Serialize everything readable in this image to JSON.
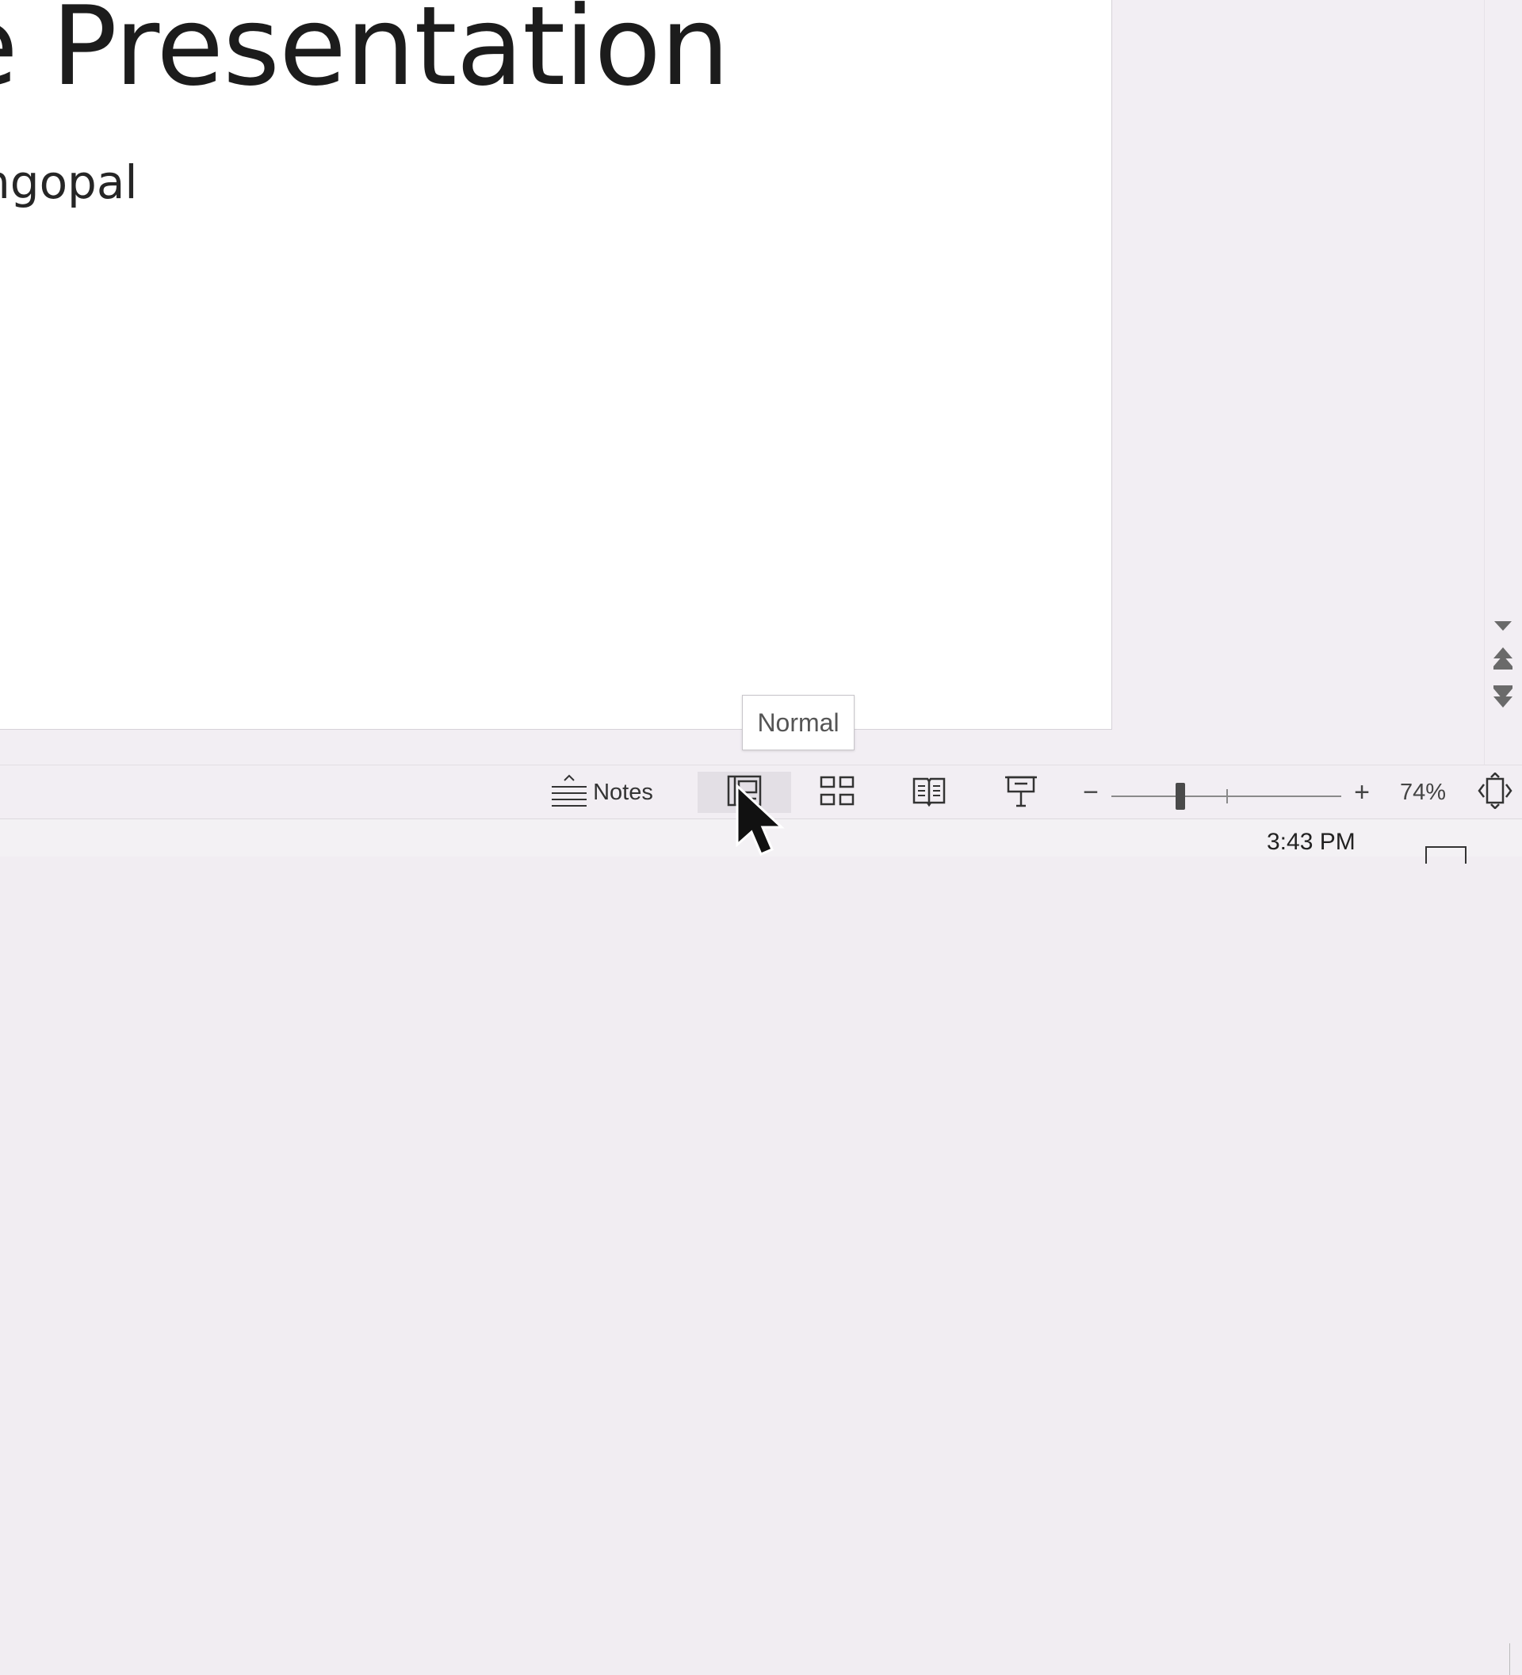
{
  "slide": {
    "title": "e Presentation",
    "subtitle": "ngopal"
  },
  "tooltip": {
    "text": "Normal"
  },
  "status_bar": {
    "notes_label": "Notes",
    "zoom_minus": "−",
    "zoom_plus": "+",
    "zoom_level": "74%",
    "zoom_fraction": 0.3
  },
  "taskbar": {
    "time": "3:43 PM"
  },
  "icons": {
    "notes": "notes-icon",
    "normal_view": "normal-view-icon",
    "slide_sorter": "slide-sorter-icon",
    "reading_view": "reading-view-icon",
    "slide_show": "slide-show-icon",
    "fit_slide": "fit-to-window-icon"
  },
  "colors": {
    "active_view_bg": "#e3dfe5",
    "workspace_bg": "#f2eef3"
  }
}
